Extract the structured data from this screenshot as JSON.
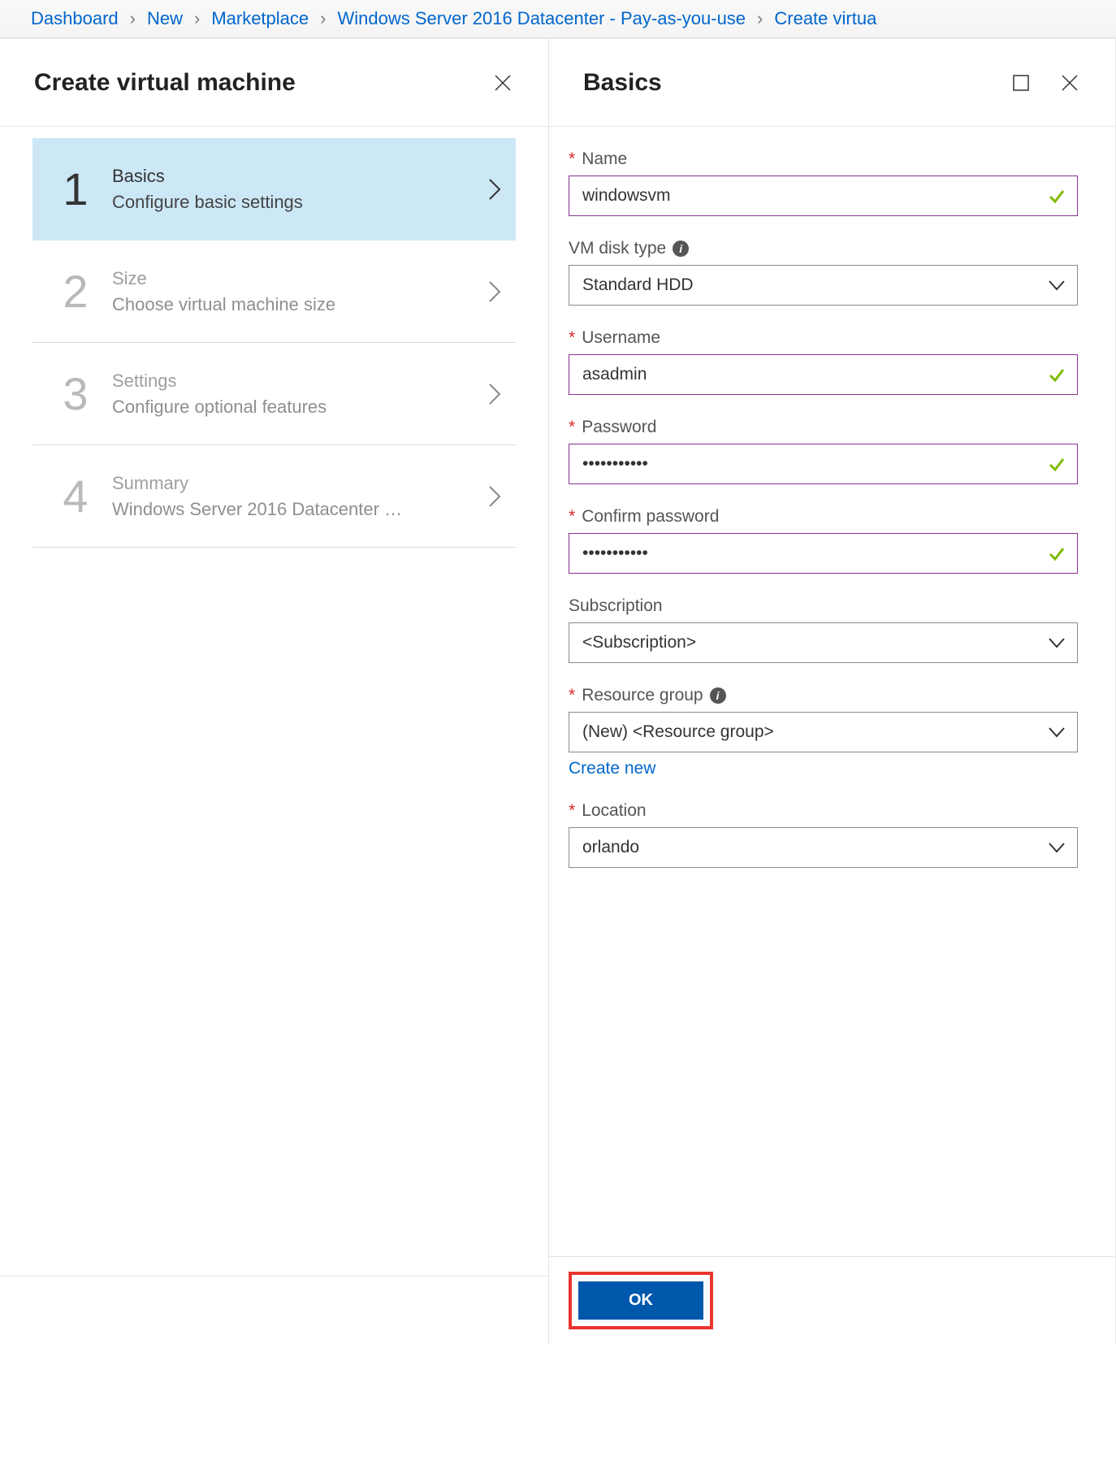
{
  "breadcrumb": [
    "Dashboard",
    "New",
    "Marketplace",
    "Windows Server 2016 Datacenter - Pay-as-you-use",
    "Create virtua"
  ],
  "left": {
    "title": "Create virtual machine",
    "steps": [
      {
        "num": "1",
        "title": "Basics",
        "sub": "Configure basic settings",
        "active": true
      },
      {
        "num": "2",
        "title": "Size",
        "sub": "Choose virtual machine size",
        "active": false
      },
      {
        "num": "3",
        "title": "Settings",
        "sub": "Configure optional features",
        "active": false
      },
      {
        "num": "4",
        "title": "Summary",
        "sub": "Windows Server 2016 Datacenter …",
        "active": false
      }
    ]
  },
  "right": {
    "title": "Basics",
    "name": {
      "label": "Name",
      "value": "windowsvm",
      "required": true,
      "valid": true
    },
    "diskType": {
      "label": "VM disk type",
      "value": "Standard HDD",
      "required": false,
      "info": true
    },
    "username": {
      "label": "Username",
      "value": "asadmin",
      "required": true,
      "valid": true
    },
    "password": {
      "label": "Password",
      "value": "•••••••••••",
      "required": true,
      "valid": true
    },
    "confirm": {
      "label": "Confirm password",
      "value": "•••••••••••",
      "required": true,
      "valid": true
    },
    "subscription": {
      "label": "Subscription",
      "value": "<Subscription>",
      "required": false
    },
    "resourceGroup": {
      "label": "Resource group",
      "value": "(New)  <Resource group>",
      "required": true,
      "info": true,
      "createNew": "Create new"
    },
    "location": {
      "label": "Location",
      "value": "orlando",
      "required": true
    },
    "ok": "OK"
  }
}
